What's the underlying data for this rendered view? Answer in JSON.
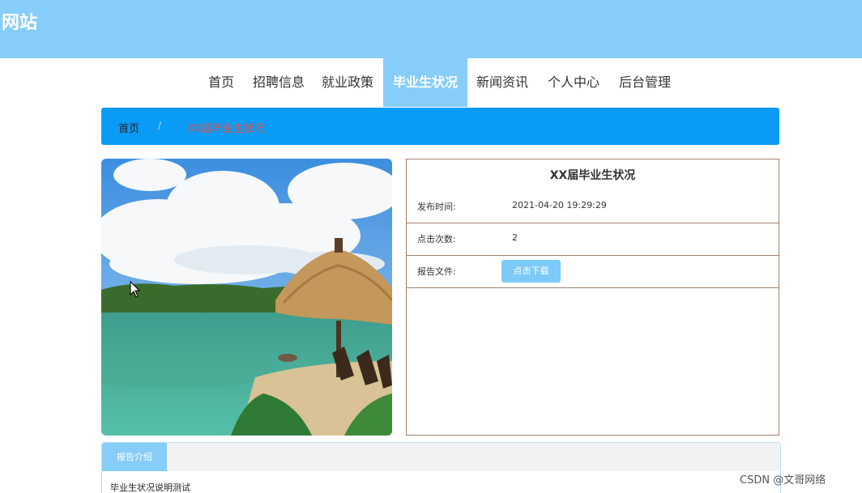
{
  "header": {
    "title": "网站",
    "bg_color": "#87cdfa"
  },
  "nav": {
    "items": [
      "首页",
      "招聘信息",
      "就业政策",
      "毕业生状况",
      "新闻资讯",
      "个人中心",
      "后台管理"
    ],
    "active_index": 3
  },
  "breadcrumb": {
    "home": "首页",
    "separator": "/",
    "current": "XX届毕业生状况"
  },
  "detail": {
    "title": "XX届毕业生状况",
    "publish_label": "发布时间:",
    "publish_value": "2021-04-20 19:29:29",
    "clicks_label": "点击次数:",
    "clicks_value": "2",
    "file_label": "报告文件:",
    "download_label": "点击下载"
  },
  "image": {
    "icon": "beach-hut-photo"
  },
  "report": {
    "tab_label": "报告介绍",
    "text": "毕业生状况说明测试"
  },
  "watermark": "CSDN @文哥网络",
  "colors": {
    "accent": "#87cdfa",
    "breadcrumb": "#0a9bf7",
    "border": "#a47f6e",
    "current_crumb": "#e0574e"
  }
}
